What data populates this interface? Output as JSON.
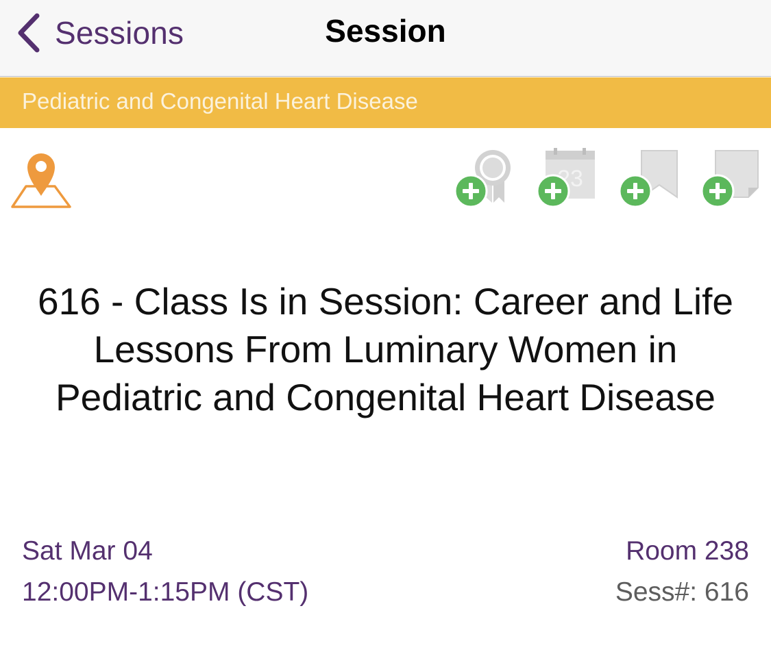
{
  "nav": {
    "back_label": "Sessions",
    "title": "Session"
  },
  "track": {
    "label": "Pediatric and Congenital Heart Disease",
    "color": "#f1bb45"
  },
  "actions": [
    {
      "icon": "map-pin-icon"
    },
    {
      "icon": "award-ribbon-add-icon"
    },
    {
      "icon": "calendar-add-icon",
      "calendar_day": "23"
    },
    {
      "icon": "bookmark-add-icon"
    },
    {
      "icon": "note-add-icon"
    }
  ],
  "session": {
    "title": "616 - Class Is in Session: Career and Life Lessons From Luminary Women in Pediatric and Congenital Heart Disease",
    "date": "Sat Mar 04",
    "time": "12:00PM-1:15PM (CST)",
    "room": "Room 238",
    "sess_number": "Sess#: 616"
  },
  "colors": {
    "accent_purple": "#54306f",
    "add_green": "#5cb85c",
    "pin_orange": "#ee9a3e",
    "icon_gray": "#dcdcdc"
  }
}
